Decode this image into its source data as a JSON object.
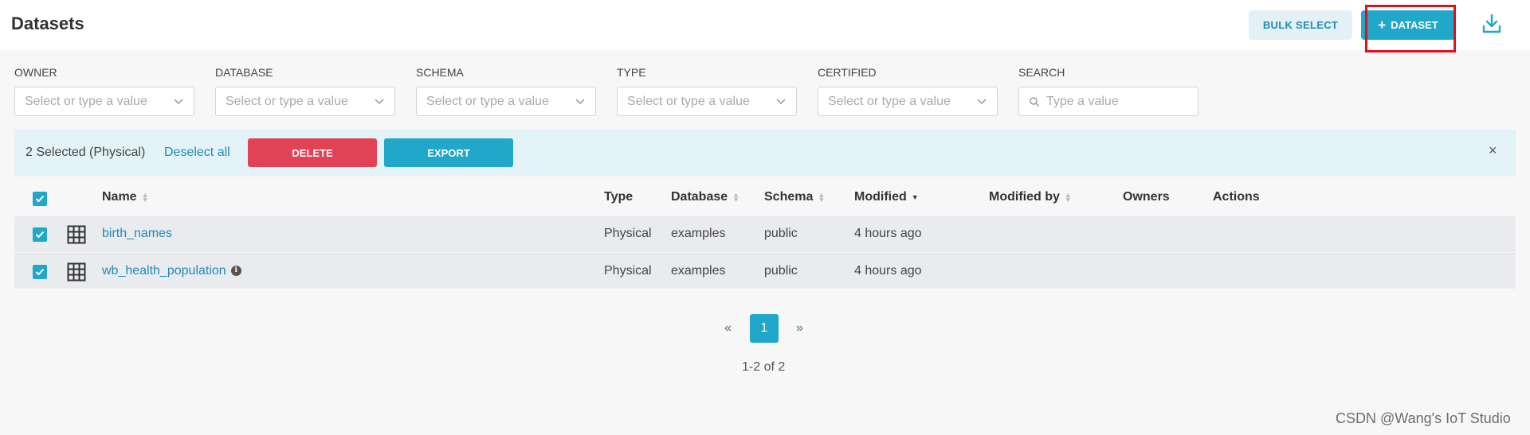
{
  "header": {
    "title": "Datasets",
    "bulk_select_label": "BULK SELECT",
    "add_dataset_label": "DATASET",
    "add_dataset_icon": "plus-icon",
    "download_icon": "download-icon"
  },
  "filters": [
    {
      "label": "OWNER",
      "placeholder": "Select or type a value"
    },
    {
      "label": "DATABASE",
      "placeholder": "Select or type a value"
    },
    {
      "label": "SCHEMA",
      "placeholder": "Select or type a value"
    },
    {
      "label": "TYPE",
      "placeholder": "Select or type a value"
    },
    {
      "label": "CERTIFIED",
      "placeholder": "Select or type a value"
    }
  ],
  "search": {
    "label": "SEARCH",
    "placeholder": "Type a value"
  },
  "bulk_bar": {
    "selected_text": "2 Selected (Physical)",
    "deselect_label": "Deselect all",
    "delete_label": "DELETE",
    "export_label": "EXPORT",
    "close_label": "×"
  },
  "table": {
    "columns": [
      "Name",
      "Type",
      "Database",
      "Schema",
      "Modified",
      "Modified by",
      "Owners",
      "Actions"
    ],
    "rows": [
      {
        "name": "birth_names",
        "type": "Physical",
        "database": "examples",
        "schema": "public",
        "modified": "4 hours ago",
        "checked": true
      },
      {
        "name": "wb_health_population",
        "type": "Physical",
        "database": "examples",
        "schema": "public",
        "modified": "4 hours ago",
        "checked": true
      }
    ]
  },
  "pagination": {
    "prev": "«",
    "page": "1",
    "next": "»",
    "count": "1-2 of 2"
  },
  "watermark": "CSDN @Wang's IoT Studio",
  "colors": {
    "accent": "#20a7c9",
    "danger": "#e04355",
    "highlight": "#e0111b"
  }
}
